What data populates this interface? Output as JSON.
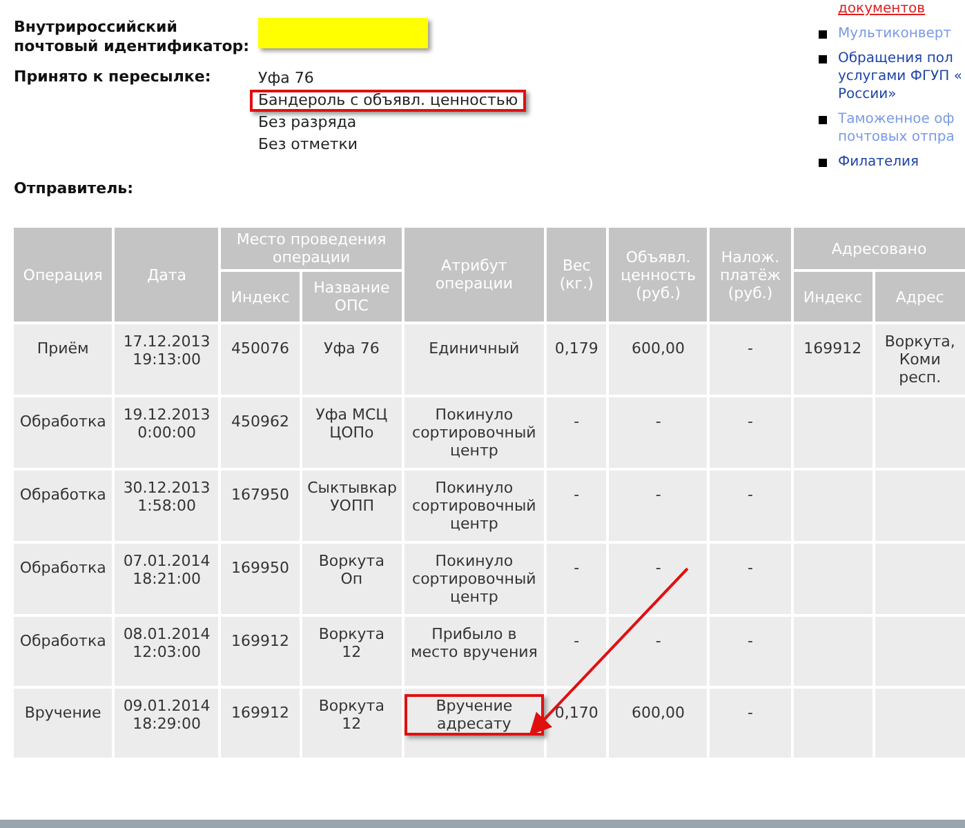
{
  "identifier": {
    "label_lines": [
      "Внутрироссийский",
      "почтовый идентификатор:"
    ],
    "redacted": true
  },
  "accepted": {
    "label": "Принято к пересылке:",
    "lines": [
      {
        "text": "Уфа 76",
        "highlighted": false
      },
      {
        "text": "Бандероль с объявл. ценностью",
        "highlighted": true
      },
      {
        "text": "Без разряда",
        "highlighted": false
      },
      {
        "text": "Без отметки",
        "highlighted": false
      }
    ]
  },
  "sender": {
    "label": "Отправитель:"
  },
  "side_links": [
    {
      "lines": [
        "документов"
      ],
      "color": "#e02020",
      "underlined": true,
      "bullet": false
    },
    {
      "lines": [
        "Мультиконверт"
      ],
      "color": "#7b9be6",
      "underlined": false,
      "bullet": true
    },
    {
      "lines": [
        "Обращения пол",
        "услугами ФГУП «",
        "России»"
      ],
      "color": "#1f45a8",
      "underlined": false,
      "bullet": true
    },
    {
      "lines": [
        "Таможенное оф",
        "почтовых отпра"
      ],
      "color": "#7b9be6",
      "underlined": false,
      "bullet": true
    },
    {
      "lines": [
        "Филателия"
      ],
      "color": "#1f45a8",
      "underlined": false,
      "bullet": true
    }
  ],
  "table": {
    "columns": {
      "operation": "Операция",
      "date": "Дата",
      "place": "Место проведения операции",
      "place_index": "Индекс",
      "place_name": "Название ОПС",
      "attribute": "Атрибут операции",
      "weight": "Вес (кг.)",
      "declared_value": "Объявл. ценность (руб.)",
      "cod": "Налож. платёж (руб.)",
      "addressed": "Адресовано",
      "addr_index": "Индекс",
      "addr_address": "Адрес"
    },
    "rows": [
      {
        "operation": "Приём",
        "date": "17.12.2013 19:13:00",
        "place_index": "450076",
        "place_name": "Уфа 76",
        "attribute": "Единичный",
        "attribute_highlighted": false,
        "weight": "0,179",
        "declared_value": "600,00",
        "cod": "-",
        "addr_index": "169912",
        "addr_address": "Воркута, Коми респ."
      },
      {
        "operation": "Обработка",
        "date": "19.12.2013 0:00:00",
        "place_index": "450962",
        "place_name": "Уфа МСЦ ЦОПо",
        "attribute": "Покинуло сортировочный центр",
        "attribute_highlighted": false,
        "weight": "-",
        "declared_value": "-",
        "cod": "-"
      },
      {
        "operation": "Обработка",
        "date": "30.12.2013 1:58:00",
        "place_index": "167950",
        "place_name": "Сыктывкар УОПП",
        "attribute": "Покинуло сортировочный центр",
        "attribute_highlighted": false,
        "weight": "-",
        "declared_value": "-",
        "cod": "-"
      },
      {
        "operation": "Обработка",
        "date": "07.01.2014 18:21:00",
        "place_index": "169950",
        "place_name": "Воркута Оп",
        "attribute": "Покинуло сортировочный центр",
        "attribute_highlighted": false,
        "weight": "-",
        "declared_value": "-",
        "cod": "-"
      },
      {
        "operation": "Обработка",
        "date": "08.01.2014 12:03:00",
        "place_index": "169912",
        "place_name": "Воркута 12",
        "attribute": "Прибыло в место вручения",
        "attribute_highlighted": false,
        "weight": "-",
        "declared_value": "-",
        "cod": "-"
      },
      {
        "operation": "Вручение",
        "date": "09.01.2014 18:29:00",
        "place_index": "169912",
        "place_name": "Воркута 12",
        "attribute": "Вручение адресату",
        "attribute_highlighted": true,
        "weight": "0,170",
        "declared_value": "600,00",
        "cod": "-"
      }
    ]
  },
  "annotation_arrow": true
}
